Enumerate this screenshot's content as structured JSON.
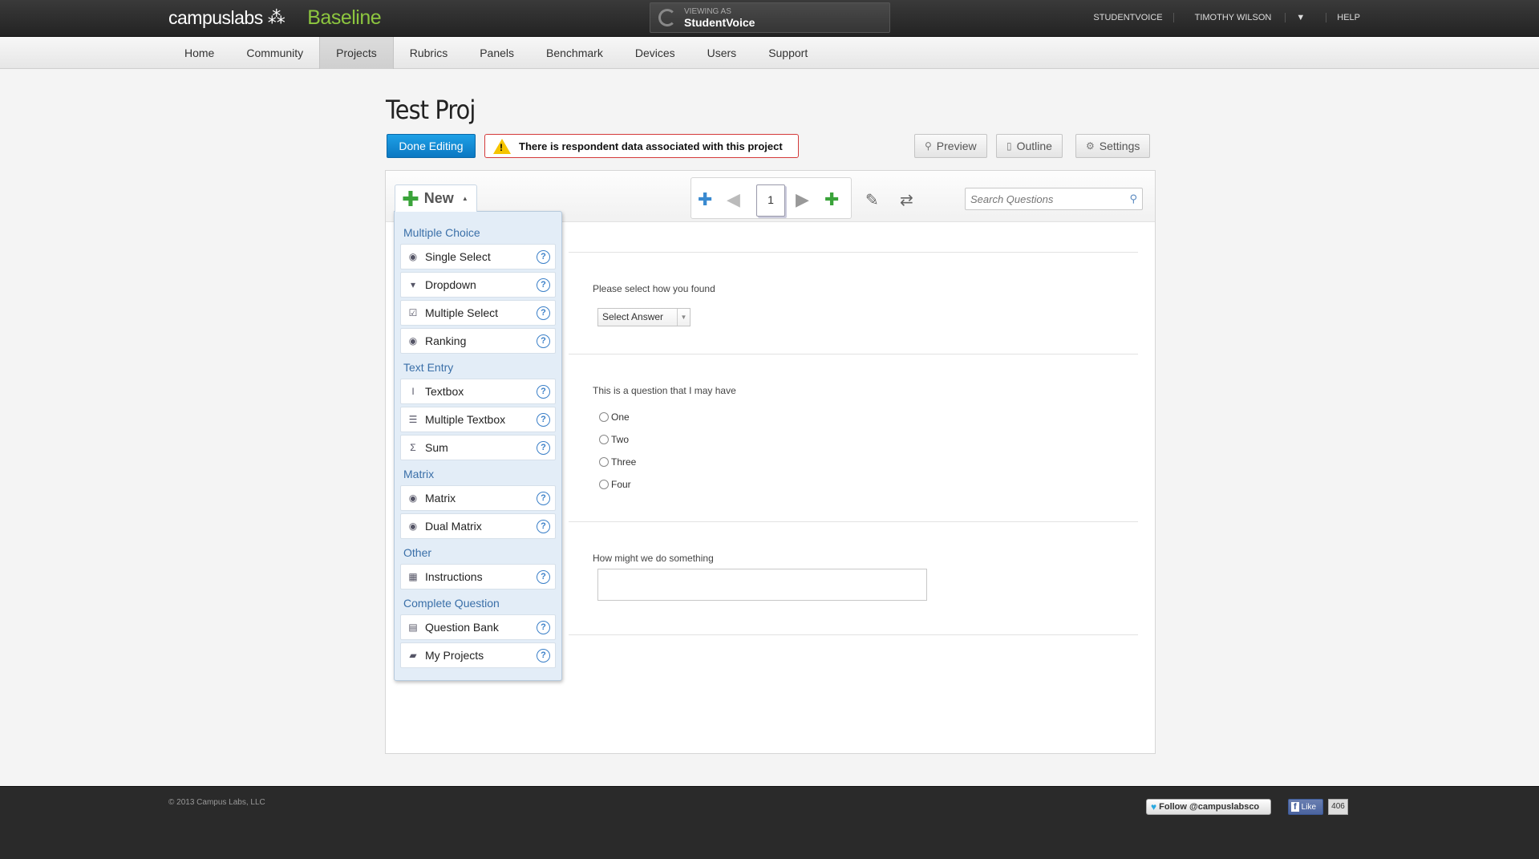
{
  "brand": {
    "company": "campuslabs",
    "product": "Baseline"
  },
  "viewing": {
    "label": "VIEWING AS",
    "value": "StudentVoice"
  },
  "toplinks": {
    "org": "STUDENTVOICE",
    "user": "TIMOTHY WILSON",
    "help": "HELP"
  },
  "nav": {
    "items": [
      {
        "label": "Home"
      },
      {
        "label": "Community"
      },
      {
        "label": "Projects"
      },
      {
        "label": "Rubrics"
      },
      {
        "label": "Panels"
      },
      {
        "label": "Benchmark"
      },
      {
        "label": "Devices"
      },
      {
        "label": "Users"
      },
      {
        "label": "Support"
      }
    ],
    "active": "Projects"
  },
  "page": {
    "title": "Test Proj",
    "done_editing": "Done Editing",
    "alert": "There is respondent data associated with this project",
    "preview": "Preview",
    "outline": "Outline",
    "settings": "Settings"
  },
  "toolbar": {
    "new_label": "New",
    "page_number": "1",
    "search_placeholder": "Search Questions"
  },
  "menu": {
    "sections": [
      {
        "title": "Multiple Choice",
        "items": [
          "Single Select",
          "Dropdown",
          "Multiple Select",
          "Ranking"
        ]
      },
      {
        "title": "Text Entry",
        "items": [
          "Textbox",
          "Multiple Textbox",
          "Sum"
        ]
      },
      {
        "title": "Matrix",
        "items": [
          "Matrix",
          "Dual Matrix"
        ]
      },
      {
        "title": "Other",
        "items": [
          "Instructions"
        ]
      },
      {
        "title": "Complete Question",
        "items": [
          "Question Bank",
          "My Projects"
        ]
      }
    ],
    "help_glyph": "?"
  },
  "questions": {
    "q1": {
      "text": "Please select how you found",
      "select_value": "Select Answer"
    },
    "q2": {
      "text": "This is a question that I may have",
      "options": [
        "One",
        "Two",
        "Three",
        "Four"
      ]
    },
    "q3": {
      "text": "How might we do something"
    }
  },
  "footer": {
    "copyright": "© 2013 Campus Labs, LLC",
    "follow": "Follow @campuslabsco",
    "like": "Like",
    "like_count": "406"
  },
  "colors": {
    "accent": "#0b78c2",
    "brand_green": "#8dc63f",
    "alert_border": "#d43a3a",
    "menu_bg": "#e3edf7"
  }
}
